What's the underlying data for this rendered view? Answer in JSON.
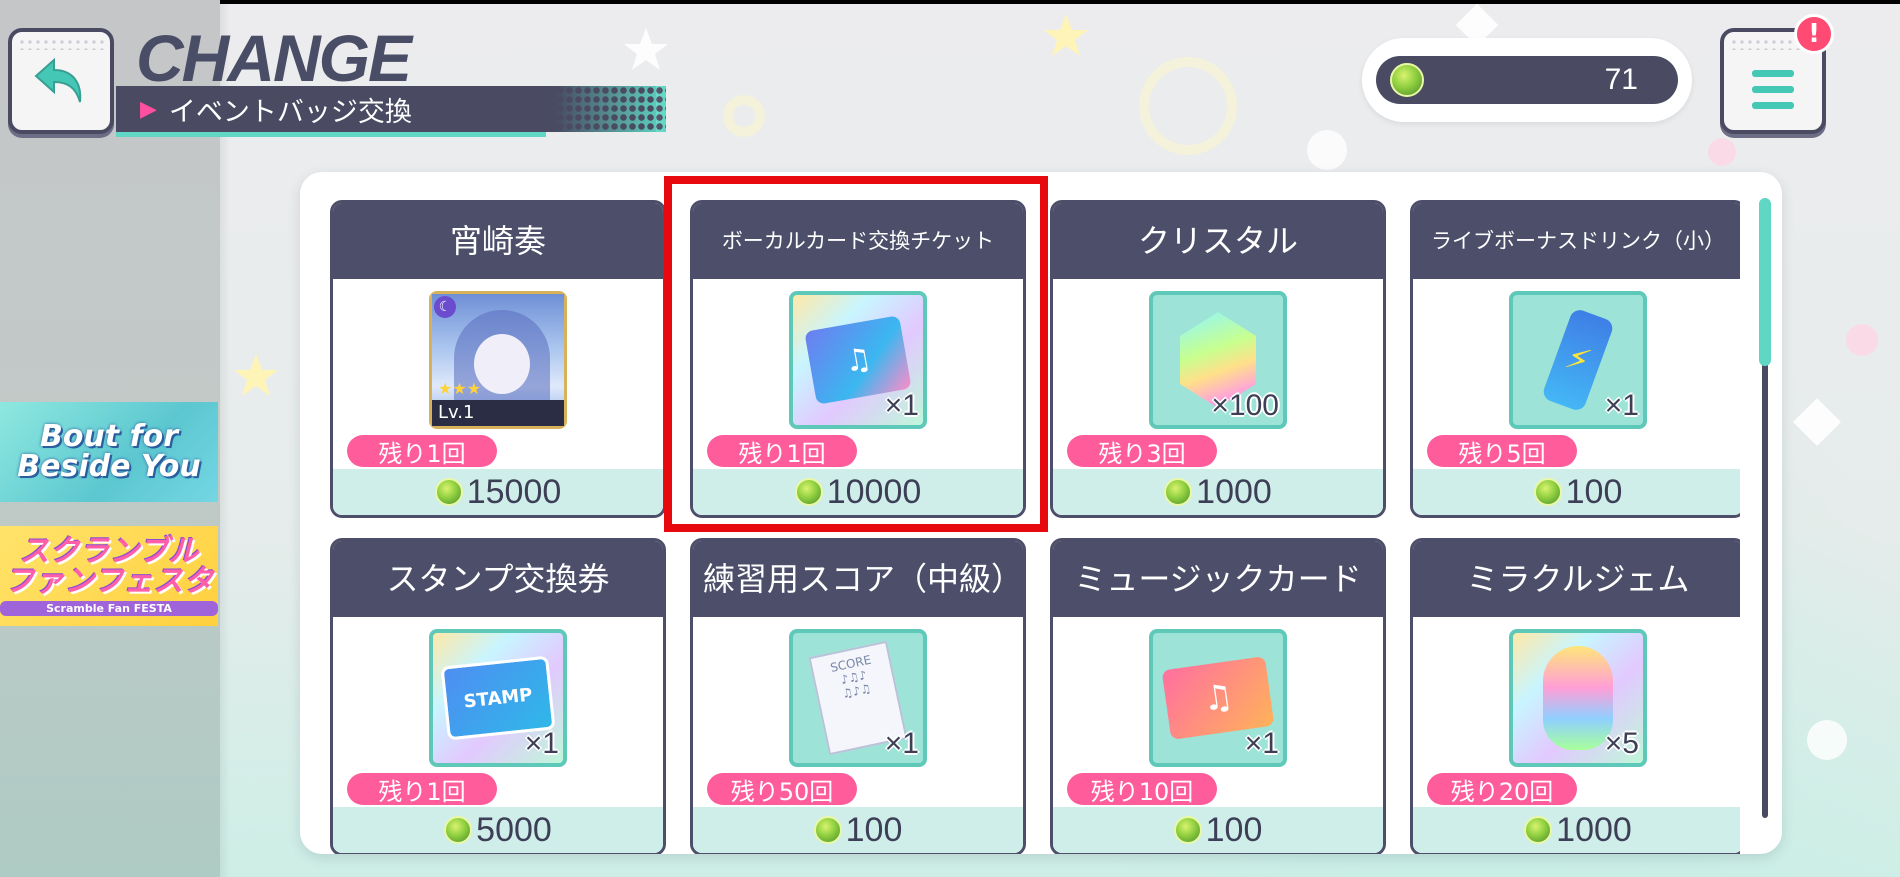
{
  "header": {
    "title": "CHANGE",
    "subtitle": "イベントバッジ交換"
  },
  "currency": {
    "icon": "badge-gem-icon",
    "value": "71"
  },
  "menu": {
    "notification": "!"
  },
  "banners": [
    {
      "label_line1": "Bout for",
      "label_line2": "Beside You"
    },
    {
      "label": "スクランブル ファンフェスタ",
      "sub": "Scramble Fan FESTA"
    }
  ],
  "items": [
    {
      "name": "宵崎奏",
      "qty": "",
      "remaining": "残り1回",
      "price": "15000",
      "art": "character-card",
      "level": "Lv.1"
    },
    {
      "name": "ボーカルカード交換チケット",
      "qty": "×1",
      "remaining": "残り1回",
      "price": "10000",
      "art": "vocal-card-ticket",
      "highlighted": true
    },
    {
      "name": "クリスタル",
      "qty": "×100",
      "remaining": "残り3回",
      "price": "1000",
      "art": "crystal"
    },
    {
      "name": "ライブボーナスドリンク（小）",
      "qty": "×1",
      "remaining": "残り5回",
      "price": "100",
      "art": "live-bonus-drink"
    },
    {
      "name": "スタンプ交換券",
      "qty": "×1",
      "remaining": "残り1回",
      "price": "5000",
      "art": "stamp-ticket"
    },
    {
      "name": "練習用スコア（中級）",
      "qty": "×1",
      "remaining": "残り50回",
      "price": "100",
      "art": "practice-score"
    },
    {
      "name": "ミュージックカード",
      "qty": "×1",
      "remaining": "残り10回",
      "price": "100",
      "art": "music-card"
    },
    {
      "name": "ミラクルジェム",
      "qty": "×5",
      "remaining": "残り20回",
      "price": "1000",
      "art": "miracle-gem"
    }
  ],
  "colors": {
    "accent": "#5fd7c4",
    "dark": "#4d4f6a",
    "pink": "#ff5c9c",
    "highlight": "#e8090f"
  }
}
